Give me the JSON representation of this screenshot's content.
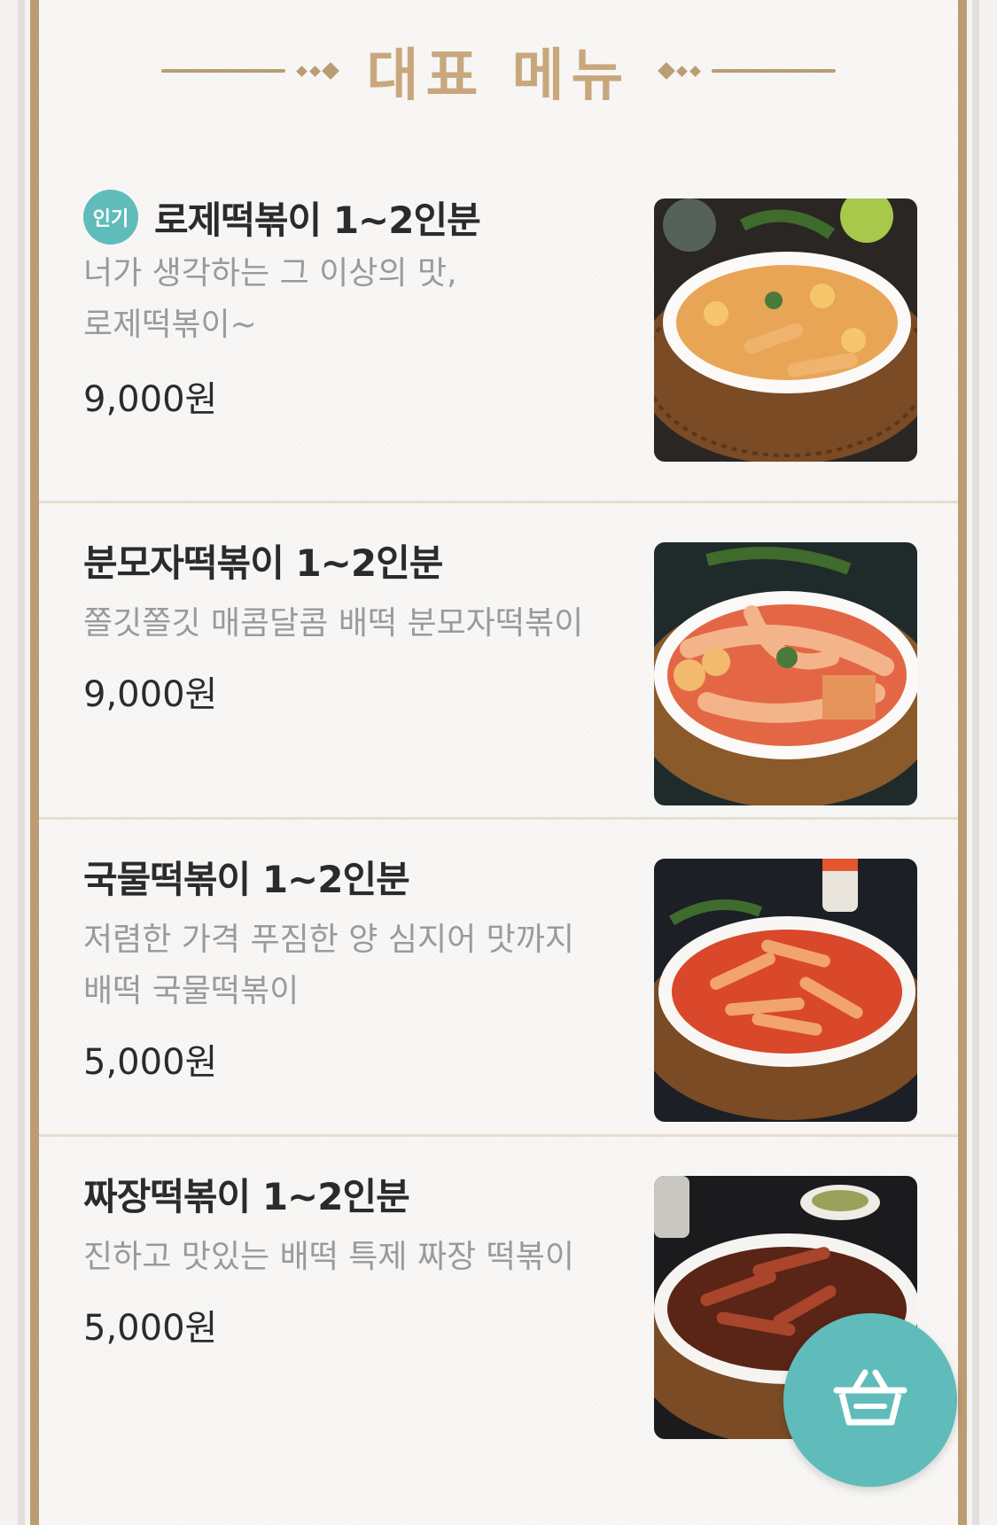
{
  "header": {
    "title": "대표 메뉴"
  },
  "menu": [
    {
      "badge": "인기",
      "name": "로제떡볶이 1~2인분",
      "description": "너가 생각하는 그 이상의 맛,\n로제떡볶이~",
      "price": "9,000원",
      "image": "rose-tteokbokki-dish"
    },
    {
      "name": "분모자떡볶이 1~2인분",
      "description": "쫄깃쫄깃 매콤달콤 배떡 분모자떡볶이",
      "price": "9,000원",
      "image": "bunmoja-tteokbokki-dish"
    },
    {
      "name": "국물떡볶이 1~2인분",
      "description": "저렴한 가격 푸짐한 양 심지어 맛까지\n배떡 국물떡볶이",
      "price": "5,000원",
      "image": "soup-tteokbokki-dish"
    },
    {
      "name": "짜장떡볶이 1~2인분",
      "description": "진하고 맛있는 배떡 특제 짜장 떡볶이",
      "price": "5,000원",
      "image": "jjajang-tteokbokki-dish"
    }
  ],
  "cart": {
    "icon": "basket-icon"
  },
  "colors": {
    "accent": "#5fbcbb",
    "frame": "#bb9c73",
    "title": "#c9a77d"
  }
}
